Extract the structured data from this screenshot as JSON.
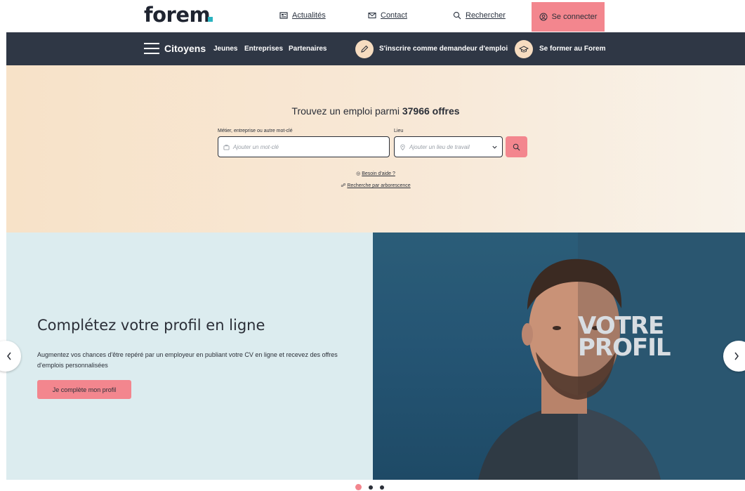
{
  "header": {
    "logo": "forem",
    "links": [
      {
        "label": "Actualités",
        "icon": "newspaper-icon"
      },
      {
        "label": "Contact",
        "icon": "mail-icon"
      },
      {
        "label": "Rechercher",
        "icon": "search-icon"
      }
    ],
    "connect_label": "Se connecter",
    "connect_icon": "user-circle-icon",
    "accent": "#f3868e",
    "logo_dot_color": "#2bb3c0"
  },
  "nav": {
    "menu_icon": "hamburger-icon",
    "current": "Citoyens",
    "items": [
      "Jeunes",
      "Entreprises",
      "Partenaires"
    ],
    "cta1": {
      "label": "S'inscrire comme demandeur d'emploi",
      "icon": "pencil-icon"
    },
    "cta2": {
      "label": "Se former au Forem",
      "icon": "graduation-cap-icon"
    },
    "background": "#2f3745"
  },
  "search": {
    "title_prefix": "Trouvez un emploi parmi",
    "offers": "37966 offres",
    "keyword_label": "Métier, entreprise ou autre mot-clé",
    "keyword_placeholder": "Ajouter un mot-clé",
    "location_label": "Lieu",
    "location_placeholder": "Ajouter un lieu de travail",
    "help_link": "Besoin d'aide ?",
    "tree_link": "Recherche par arborescence"
  },
  "carousel": {
    "title": "Complétez votre profil en ligne",
    "text": "Augmentez vos chances d'être repéré par un employeur en publiant votre CV en ligne et recevez des offres d'emplois personnalisées",
    "button": "Je complète mon profil",
    "image_text_line1": "VOTRE",
    "image_text_line2": "PROFIL",
    "slides_count": 3,
    "active_slide": 1
  }
}
